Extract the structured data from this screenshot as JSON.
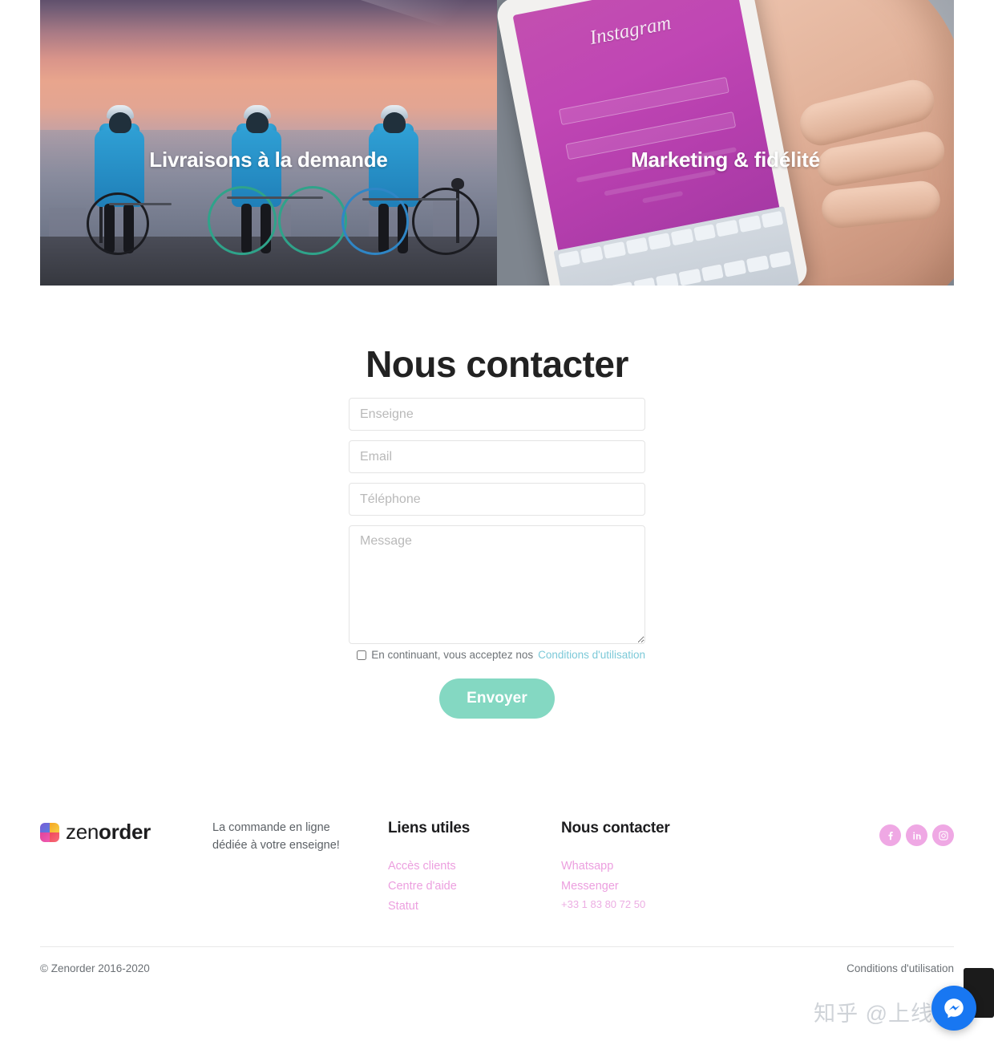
{
  "hero": {
    "cards": [
      {
        "label": "Livraisons à la demande",
        "image_alt": "stuart-couriers-photo"
      },
      {
        "label": "Marketing & fidélité",
        "image_alt": "instagram-phone-photo"
      }
    ]
  },
  "main": {
    "title": "Nous contacter",
    "form": {
      "enseigne_placeholder": "Enseigne",
      "email_placeholder": "Email",
      "telephone_placeholder": "Téléphone",
      "message_placeholder": "Message",
      "terms_text": "En continuant, vous acceptez nos",
      "terms_link": "Conditions d'utilisation",
      "submit_label": "Envoyer"
    }
  },
  "footer": {
    "brand": {
      "name_light": "zen",
      "name_bold": "order"
    },
    "tagline": "La commande en ligne dédiée à votre enseigne!",
    "links_column": {
      "title": "Liens utiles",
      "items": [
        "Accès clients",
        "Centre d'aide",
        "Statut"
      ]
    },
    "contact_column": {
      "title": "Nous contacter",
      "items": [
        "Whatsapp",
        "Messenger"
      ],
      "phone": "+33 1 83 80 72 50"
    },
    "socials": [
      {
        "name": "facebook",
        "label": "f"
      },
      {
        "name": "linkedin",
        "label": "in"
      },
      {
        "name": "instagram",
        "label": "ig"
      }
    ],
    "copyright": "© Zenorder 2016-2020",
    "terms_link": "Conditions d'utilisation"
  },
  "overlay": {
    "watermark": "知乎 @上线了"
  },
  "colors": {
    "accent_button": "#84d8c2",
    "link_pink": "#ec9fdf",
    "social_pink": "#efa8e4",
    "terms_link": "#7cc9d8",
    "text_dark": "#1d1d1f",
    "chat_blue": "#1877f2"
  }
}
